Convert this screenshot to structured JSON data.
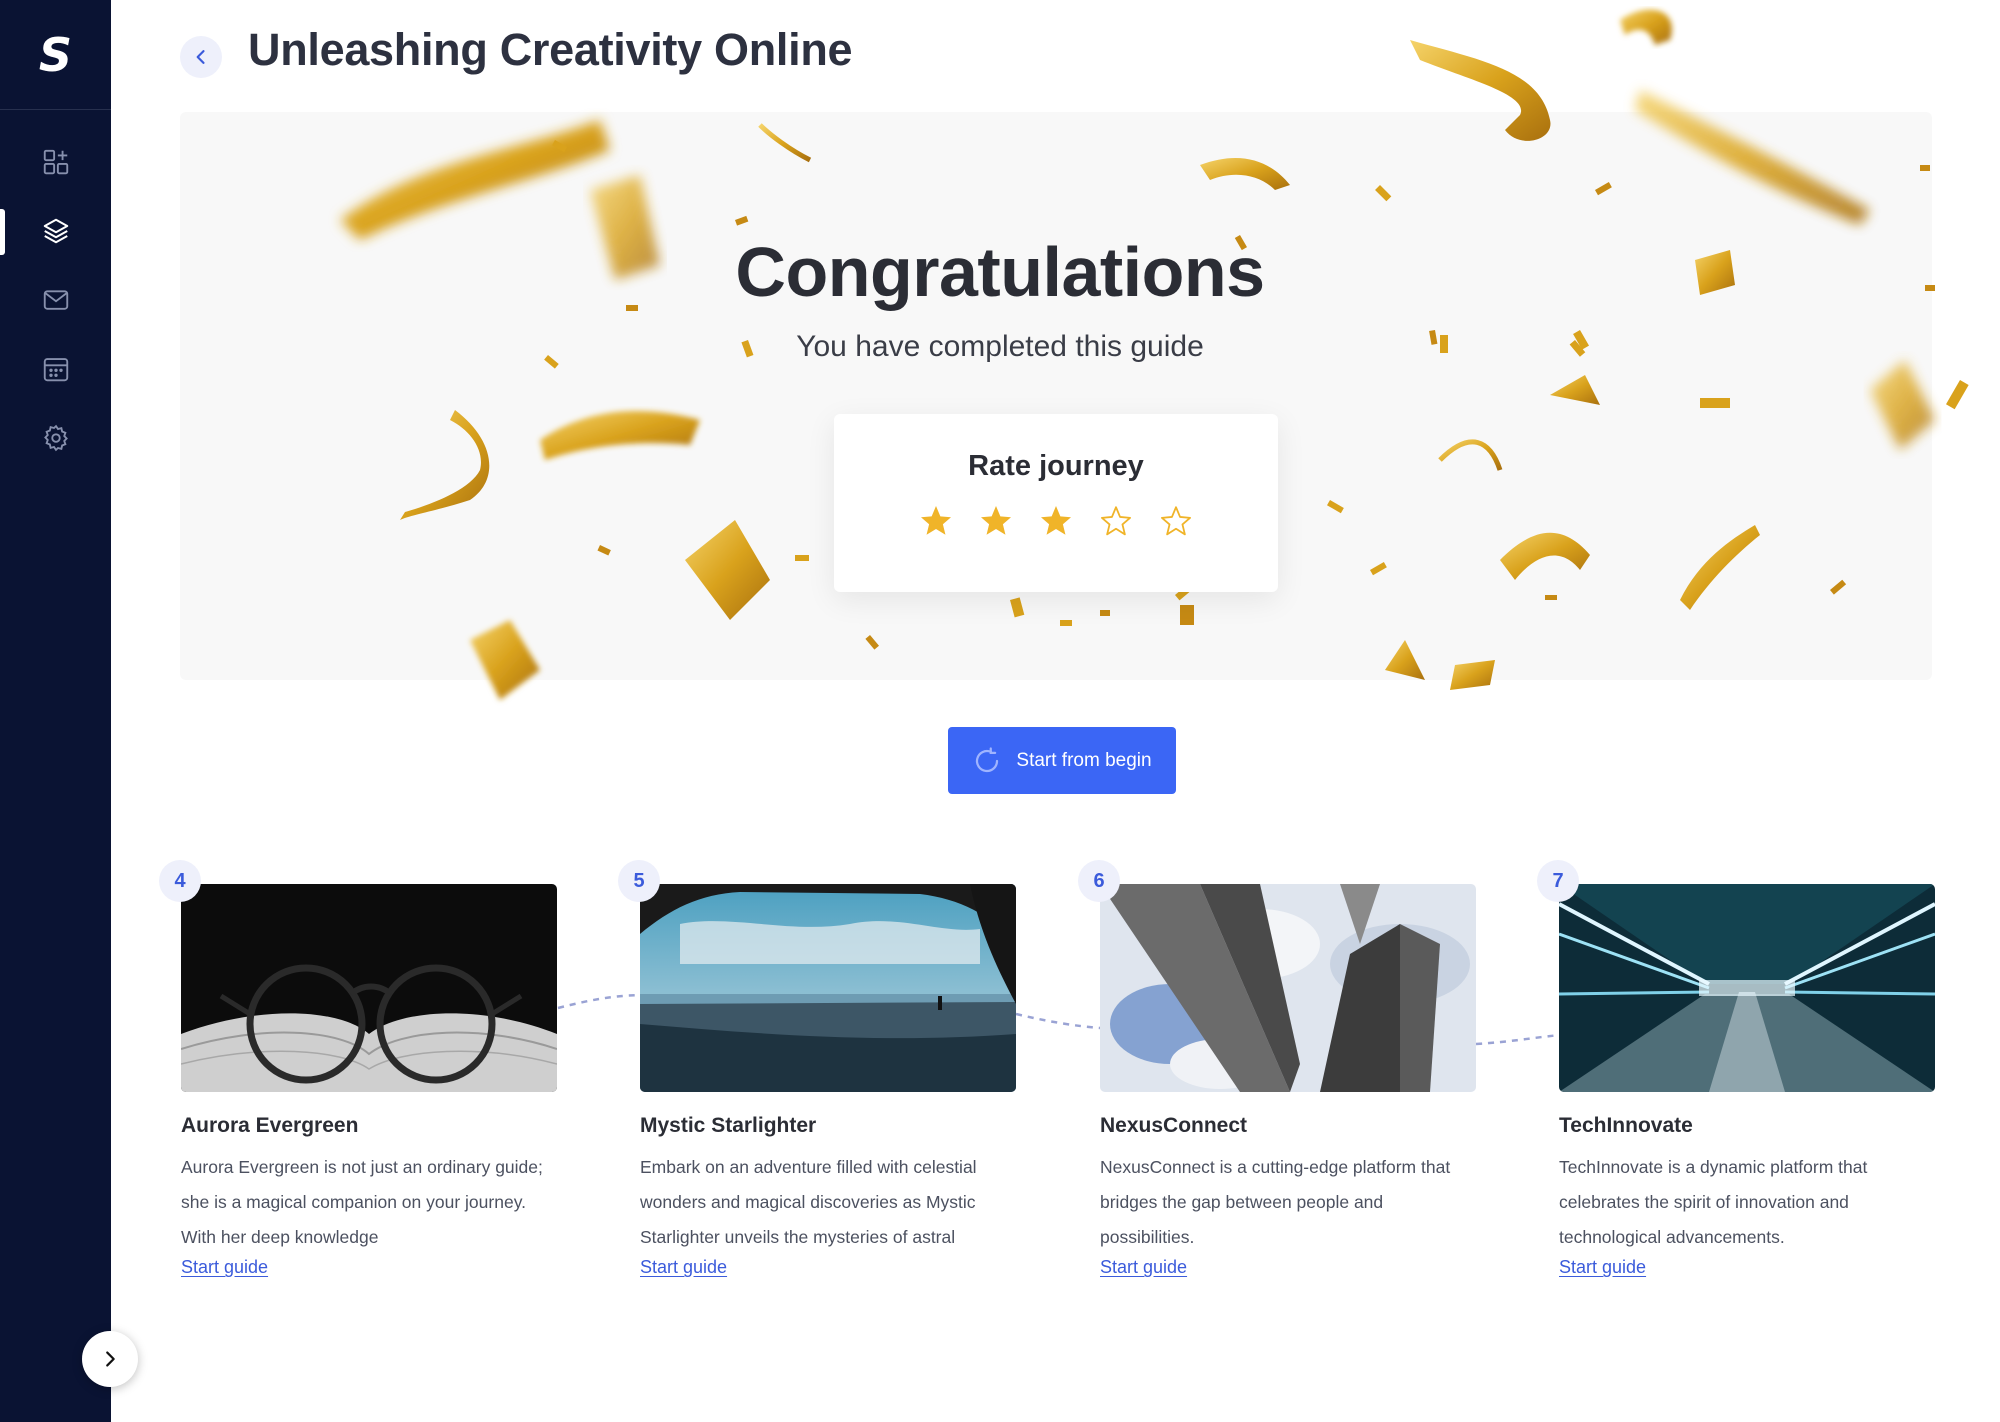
{
  "app": {
    "logo_text": "S"
  },
  "sidebar": {
    "items": [
      {
        "name": "dashboard",
        "icon": "grid-plus-icon",
        "active": false
      },
      {
        "name": "guides",
        "icon": "layers-icon",
        "active": true
      },
      {
        "name": "messages",
        "icon": "mail-icon",
        "active": false
      },
      {
        "name": "calendar",
        "icon": "calendar-icon",
        "active": false
      },
      {
        "name": "settings",
        "icon": "gear-icon",
        "active": false
      }
    ],
    "expand_icon": "chevron-right-icon"
  },
  "header": {
    "back_icon": "chevron-left-icon",
    "title": "Unleashing Creativity Online"
  },
  "hero": {
    "heading": "Congratulations",
    "subheading": "You have completed this guide",
    "rating": {
      "title": "Rate journey",
      "value": 3,
      "max": 5
    }
  },
  "restart_button": {
    "label": "Start from begin",
    "icon": "refresh-icon"
  },
  "guides": [
    {
      "number": "4",
      "title": "Aurora Evergreen",
      "description": "Aurora Evergreen is not just an ordinary guide; she is a magical companion on your journey. With her deep knowledge",
      "link": "Start guide"
    },
    {
      "number": "5",
      "title": "Mystic Starlighter",
      "description": "Embark on an adventure filled with celestial wonders and magical discoveries as Mystic Starlighter unveils the mysteries of astral",
      "link": "Start guide"
    },
    {
      "number": "6",
      "title": "NexusConnect",
      "description": "NexusConnect is a cutting-edge platform that bridges the gap between people and possibilities.",
      "link": "Start guide"
    },
    {
      "number": "7",
      "title": "TechInnovate",
      "description": "TechInnovate is a dynamic platform that celebrates the spirit of innovation and technological advancements.",
      "link": "Start guide"
    }
  ],
  "colors": {
    "sidebar_bg": "#0a1333",
    "accent": "#3b66f5",
    "link": "#3b5bdb",
    "star_gold": "#f0b429",
    "confetti_gold": "#d9a21c"
  }
}
